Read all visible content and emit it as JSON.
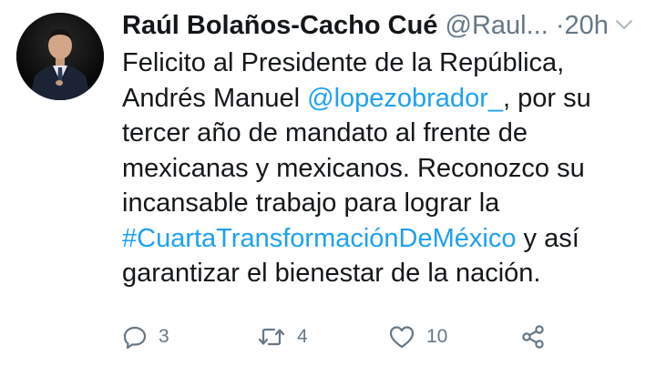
{
  "tweet": {
    "author": {
      "display_name": "Raúl Bolaños-Cacho Cué",
      "handle": "@Raul...",
      "separator": "·",
      "time": "20h"
    },
    "text_lines": [
      [
        {
          "t": "Felicito al Presidente de la República,"
        }
      ],
      [
        {
          "t": "Andrés Manuel "
        },
        {
          "t": "@lopezobrador_",
          "link": true
        },
        {
          "t": ", por su"
        }
      ],
      [
        {
          "t": "tercer año de mandato al frente de"
        }
      ],
      [
        {
          "t": "mexicanas y mexicanos. Reconozco su"
        }
      ],
      [
        {
          "t": "incansable trabajo para lograr la"
        }
      ],
      [
        {
          "t": "#CuartaTransformaciónDeMéxico",
          "link": true
        },
        {
          "t": " y así"
        }
      ],
      [
        {
          "t": "garantizar el bienestar de la nación."
        }
      ]
    ],
    "actions": {
      "reply": {
        "icon": "reply-icon",
        "count": "3"
      },
      "retweet": {
        "icon": "retweet-icon",
        "count": "4"
      },
      "like": {
        "icon": "heart-icon",
        "count": "10"
      },
      "share": {
        "icon": "share-icon"
      }
    }
  },
  "colors": {
    "text": "#14171a",
    "secondary": "#657786",
    "link": "#1da1f2",
    "background": "#ffffff"
  }
}
